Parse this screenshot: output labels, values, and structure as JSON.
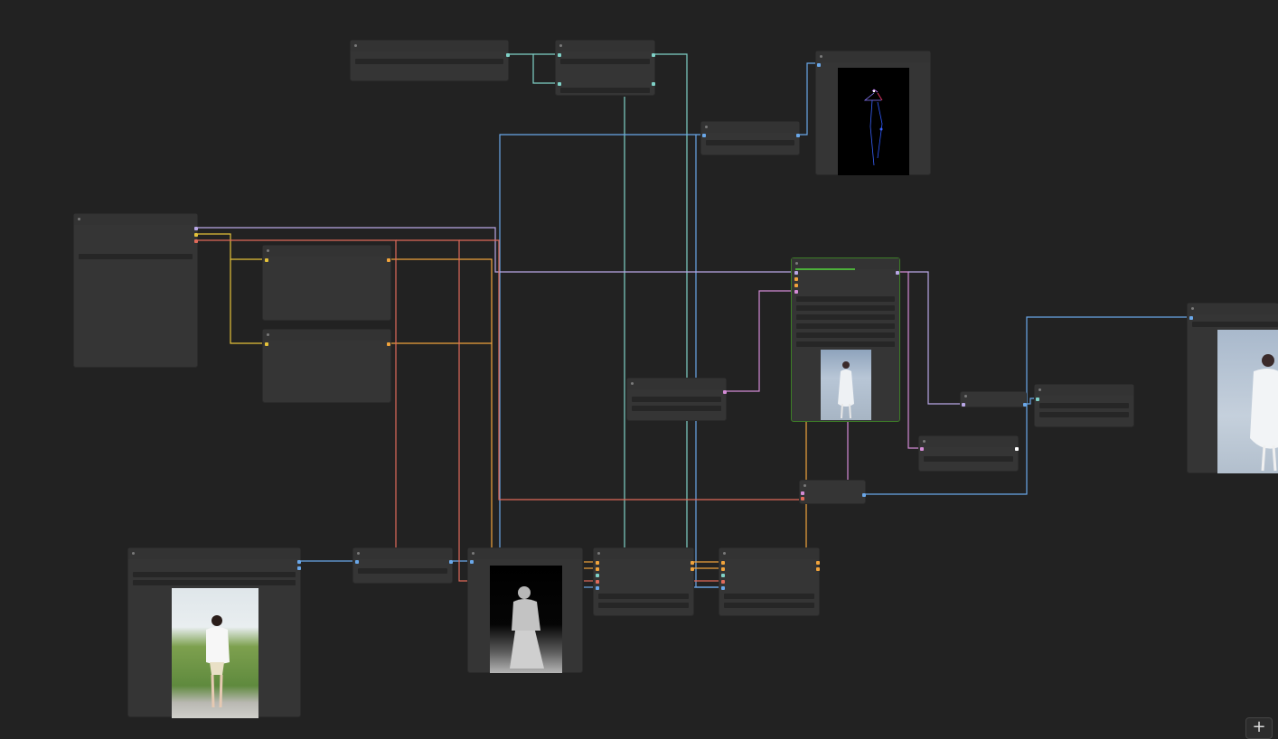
{
  "canvas": {
    "background": "#222222"
  },
  "toolbar": {
    "add_button_label": "+"
  },
  "node_tag": "",
  "colors": {
    "cyan": "#7fd1c7",
    "blue": "#6aa7e8",
    "lilac": "#b9a7e6",
    "yellow": "#e5c23a",
    "orange": "#f0a33c",
    "red": "#e06a5a",
    "pink": "#d38bd5",
    "green": "#4caf3a"
  },
  "icons": [
    "add-icon"
  ]
}
